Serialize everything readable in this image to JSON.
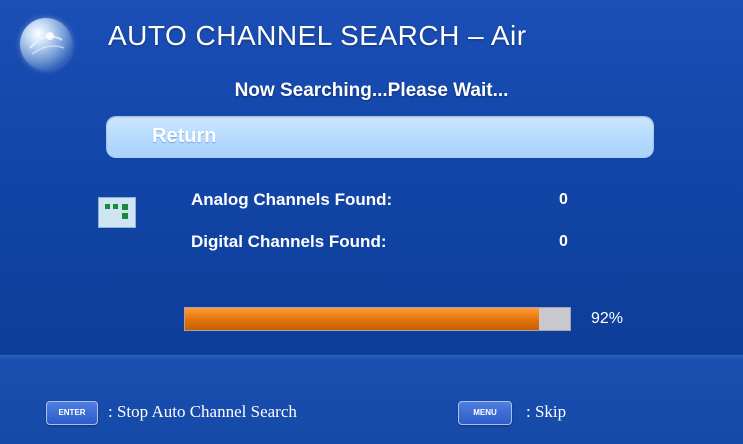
{
  "header": {
    "title": "AUTO CHANNEL SEARCH – Air",
    "icon": "satellite-globe-icon"
  },
  "status_text": "Now Searching...Please Wait...",
  "return_button": {
    "label": "Return"
  },
  "results": [
    {
      "label": "Analog Channels Found:",
      "value": "0"
    },
    {
      "label": "Digital Channels Found:",
      "value": "0"
    }
  ],
  "progress": {
    "percent": 92,
    "label": "92%"
  },
  "footer": {
    "enter_key": "ENTER",
    "enter_hint": ": Stop Auto Channel Search",
    "menu_key": "MENU",
    "menu_hint": ": Skip"
  },
  "colors": {
    "background": "#1246a9",
    "progress_fill": "#e27209",
    "progress_track": "#c9c9cd",
    "return_button": "#b8dcff"
  }
}
